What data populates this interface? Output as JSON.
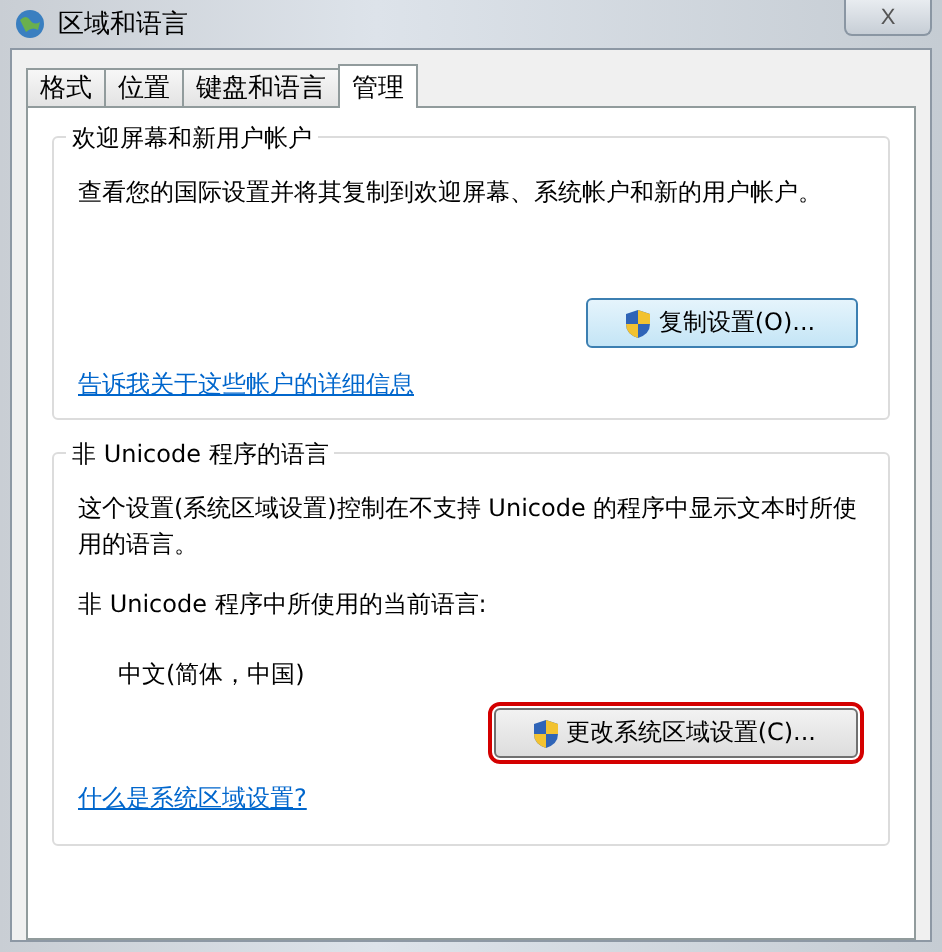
{
  "window": {
    "title": "区域和语言",
    "close_label": "X"
  },
  "tabs": [
    {
      "label": "格式",
      "selected": false
    },
    {
      "label": "位置",
      "selected": false
    },
    {
      "label": "键盘和语言",
      "selected": false
    },
    {
      "label": "管理",
      "selected": true
    }
  ],
  "groups": [
    {
      "title": "欢迎屏幕和新用户帐户",
      "kind": "welcome",
      "paragraphs": [
        "查看您的国际设置并将其复制到欢迎屏幕、系统帐户和新的用户帐户。"
      ],
      "button": {
        "label": "复制设置(O)...",
        "highlighted": false
      },
      "link": "告诉我关于这些帐户的详细信息"
    },
    {
      "title": "非 Unicode 程序的语言",
      "kind": "unicode",
      "paragraphs": [
        "这个设置(系统区域设置)控制在不支持 Unicode 的程序中显示文本时所使用的语言。",
        "非 Unicode 程序中所使用的当前语言:"
      ],
      "current_value": "中文(简体，中国)",
      "button": {
        "label": "更改系统区域设置(C)...",
        "highlighted": true
      },
      "link": "什么是系统区域设置?"
    }
  ]
}
